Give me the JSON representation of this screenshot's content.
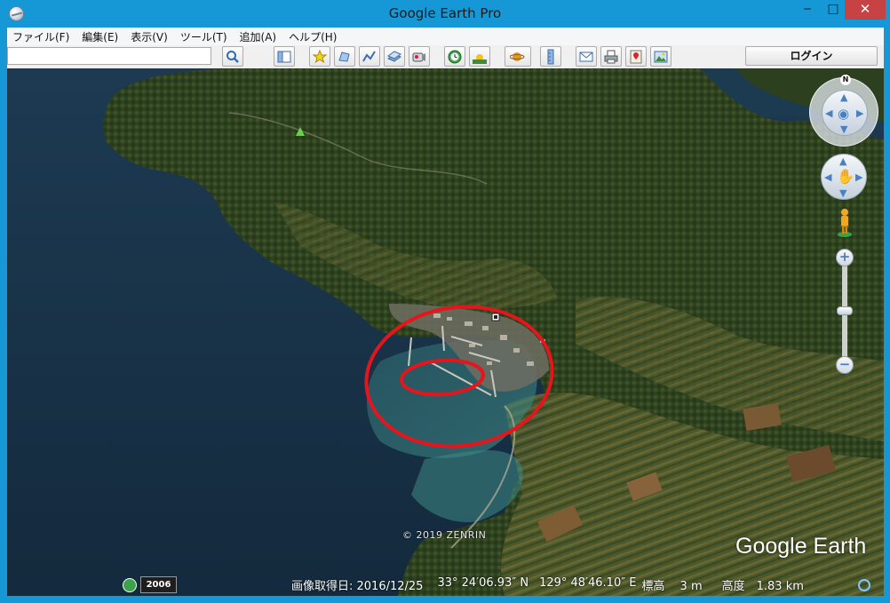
{
  "window": {
    "title": "Google Earth Pro",
    "controls": {
      "minimize": "‒",
      "maximize": "□",
      "close": "✕"
    }
  },
  "menu": {
    "items": [
      "ファイル(F)",
      "編集(E)",
      "表示(V)",
      "ツール(T)",
      "追加(A)",
      "ヘルプ(H)"
    ]
  },
  "toolbar": {
    "search_value": "",
    "login_label": "ログイン",
    "buttons": [
      "search-icon",
      "sidebar-toggle-icon",
      "placemark-icon",
      "polygon-icon",
      "path-icon",
      "image-overlay-icon",
      "record-tour-icon",
      "historical-imagery-icon",
      "sunlight-icon",
      "planets-icon",
      "ruler-icon",
      "email-icon",
      "print-icon",
      "google-maps-icon",
      "save-image-icon"
    ]
  },
  "map": {
    "copyright": "© 2019 ZENRIN",
    "logo": "Google Earth",
    "compass_letter": "N",
    "annotation_color": "#e8141b",
    "history_year": "2006"
  },
  "status": {
    "imagery_date": "画像取得日: 2016/12/25",
    "lat": "33° 24′06.93″ N",
    "lon": "129° 48′46.10″ E",
    "elevation": "標高　 3 m",
    "eye_alt": "高度　1.83 km"
  }
}
